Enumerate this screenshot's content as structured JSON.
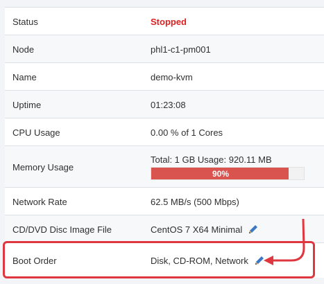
{
  "rows": [
    {
      "label": "Status",
      "value": "Stopped"
    },
    {
      "label": "Node",
      "value": "phl1-c1-pm001"
    },
    {
      "label": "Name",
      "value": "demo-kvm"
    },
    {
      "label": "Uptime",
      "value": "01:23:08"
    },
    {
      "label": "CPU Usage",
      "value": "0.00 % of 1 Cores"
    },
    {
      "label": "Memory Usage",
      "value": "Total: 1 GB Usage: 920.11 MB",
      "bar_label": "90%",
      "bar_fraction": 0.9
    },
    {
      "label": "Network Rate",
      "value": "62.5 MB/s (500 Mbps)"
    },
    {
      "label": "CD/DVD Disc Image File",
      "value": "CentOS 7 X64 Minimal"
    },
    {
      "label": "Boot Order",
      "value": "Disk, CD-ROM, Network"
    }
  ],
  "icons": {
    "edit": "pencil-icon"
  },
  "colors": {
    "stopped": "#e02020",
    "bar_fill": "#d9534f",
    "annotation": "#e0363f",
    "pencil": "#3c78c3"
  }
}
